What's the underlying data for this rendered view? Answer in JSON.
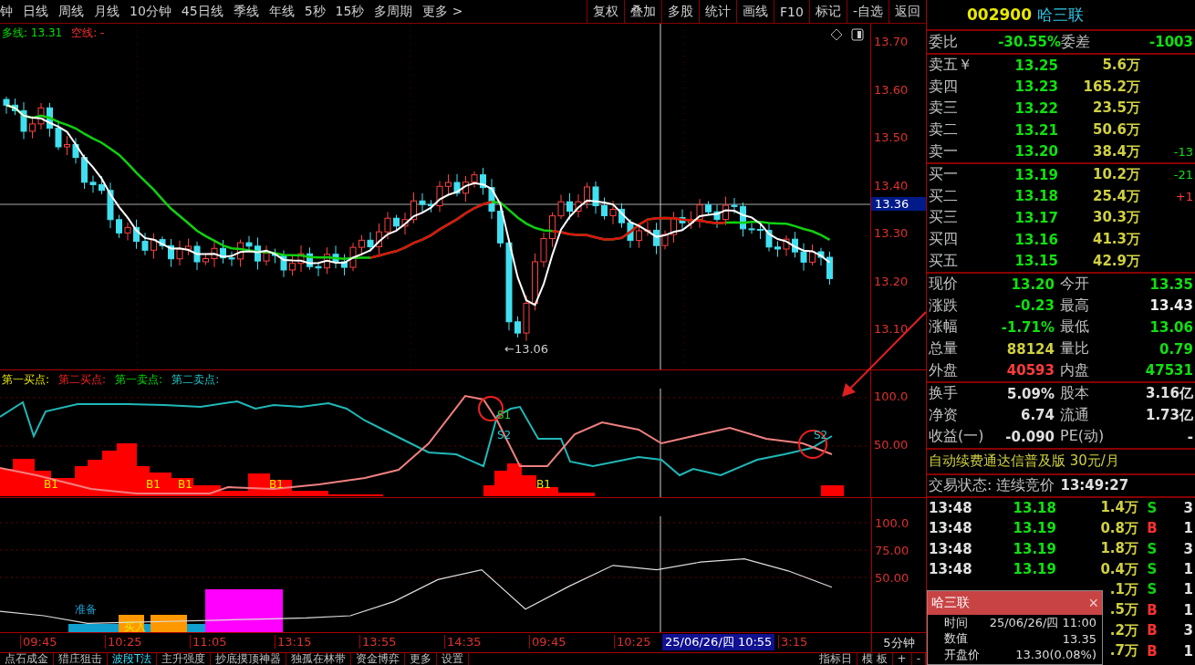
{
  "toolbar": {
    "periods": [
      "钟",
      "日线",
      "周线",
      "月线",
      "10分钟",
      "45日线",
      "季线",
      "年线",
      "5秒",
      "15秒",
      "多周期",
      "更多 >"
    ],
    "actions": [
      "复权",
      "叠加",
      "多股",
      "统计",
      "画线",
      "F10",
      "标记",
      "-自选",
      "返回"
    ]
  },
  "main_chart": {
    "legend": [
      {
        "label": "多线:",
        "value": "13.31",
        "kind": "long"
      },
      {
        "label": "空线:",
        "value": "-",
        "kind": "short"
      }
    ],
    "y_labels": [
      "13.70",
      "13.60",
      "13.50",
      "13.40",
      "13.30",
      "13.20",
      "13.10"
    ],
    "cursor_price": "13.36",
    "low_label": "←13.06"
  },
  "indicator_1": {
    "legend": [
      {
        "label": "第一买点:",
        "kind": "buy1"
      },
      {
        "label": "第二买点:",
        "kind": "buy2"
      },
      {
        "label": "第一卖点:",
        "kind": "sell1"
      },
      {
        "label": "第二卖点:",
        "kind": "sell2"
      }
    ],
    "y_labels": [
      "100.0",
      "50.00"
    ],
    "marks": [
      {
        "text": "B1",
        "kind": "buy"
      },
      {
        "text": "B1",
        "kind": "buy"
      },
      {
        "text": "B1",
        "kind": "buy"
      },
      {
        "text": "B1",
        "kind": "buy"
      },
      {
        "text": "S1",
        "kind": "sell1"
      },
      {
        "text": "S2",
        "kind": "sell2"
      },
      {
        "text": "B1",
        "kind": "buy"
      },
      {
        "text": "S2",
        "kind": "sell2"
      }
    ]
  },
  "indicator_2": {
    "chart_data": {
      "type": "line",
      "grid": true,
      "ylim": [
        -0.8,
        122.5
      ],
      "yticks": [
        {
          "value": 100,
          "label": "100.0"
        },
        {
          "value": 75,
          "label": "75.00"
        },
        {
          "value": 50,
          "label": "50.00"
        }
      ],
      "series": [
        {
          "color": "#dddddd",
          "values": [
            19,
            15,
            8,
            9,
            10,
            11,
            12,
            13,
            15,
            28,
            48,
            57,
            21,
            42,
            61,
            57,
            64,
            67,
            56,
            41
          ]
        }
      ]
    },
    "marks": [
      {
        "text": "准备",
        "kind": "ready"
      },
      {
        "text": "买入",
        "kind": "buy"
      }
    ]
  },
  "x_axis": {
    "labels": [
      "09:45",
      "10:25",
      "11:05",
      "13:15",
      "13:55",
      "14:35",
      "09:45",
      "10:25"
    ],
    "cursor": "25/06/26/四 10:55",
    "cut_label": "3:15",
    "period": "5分钟"
  },
  "bottom_tabs": [
    {
      "label": "点石成金",
      "selected": false
    },
    {
      "label": "猎庄狙击",
      "selected": false
    },
    {
      "label": "波段T法",
      "selected": true
    },
    {
      "label": "主升强度",
      "selected": false
    },
    {
      "label": "抄底摸顶神器",
      "selected": false
    },
    {
      "label": "独孤在林带",
      "selected": false
    },
    {
      "label": "资金博弈",
      "selected": false
    },
    {
      "label": "更多",
      "selected": false
    },
    {
      "label": "设置",
      "selected": false
    }
  ],
  "bottom_actions": [
    "指标日",
    "模 板",
    "+",
    "-"
  ],
  "quote_panel": {
    "code": "002900",
    "name": "哈三联",
    "ratio": {
      "label": "委比",
      "value": "-30.55%",
      "diff_label": "委差",
      "diff": "-1003"
    },
    "asks": [
      {
        "label": "卖五￥",
        "price": "13.25",
        "volume": "5.6万"
      },
      {
        "label": "卖四",
        "price": "13.23",
        "volume": "165.2万"
      },
      {
        "label": "卖三",
        "price": "13.22",
        "volume": "23.5万"
      },
      {
        "label": "卖二",
        "price": "13.21",
        "volume": "50.6万"
      },
      {
        "label": "卖一",
        "price": "13.20",
        "volume": "38.4万",
        "change": "-13",
        "kind": "down"
      }
    ],
    "bids": [
      {
        "label": "买一",
        "price": "13.19",
        "volume": "10.2万",
        "change": "-21",
        "kind": "down"
      },
      {
        "label": "买二",
        "price": "13.18",
        "volume": "25.4万",
        "change": "+1",
        "kind": "up"
      },
      {
        "label": "买三",
        "price": "13.17",
        "volume": "30.3万"
      },
      {
        "label": "买四",
        "price": "13.16",
        "volume": "41.3万"
      },
      {
        "label": "买五",
        "price": "13.15",
        "volume": "42.9万"
      }
    ],
    "stats": [
      [
        {
          "label": "现价",
          "value": "13.20",
          "kind": "down"
        },
        {
          "label": "今开",
          "value": "13.35",
          "kind": "down"
        }
      ],
      [
        {
          "label": "涨跌",
          "value": "-0.23",
          "kind": "down"
        },
        {
          "label": "最高",
          "value": "13.43",
          "kind": "flat"
        }
      ],
      [
        {
          "label": "涨幅",
          "value": "-1.71%",
          "kind": "down"
        },
        {
          "label": "最低",
          "value": "13.06",
          "kind": "down"
        }
      ],
      [
        {
          "label": "总量",
          "value": "88124",
          "kind": "volume"
        },
        {
          "label": "量比",
          "value": "0.79",
          "kind": "down"
        }
      ],
      [
        {
          "label": "外盘",
          "value": "40593",
          "kind": "up"
        },
        {
          "label": "内盘",
          "value": "47531",
          "kind": "down"
        }
      ]
    ],
    "fundamentals": [
      [
        {
          "label": "换手",
          "value": "5.09%"
        },
        {
          "label": "股本",
          "value": "3.16亿"
        }
      ],
      [
        {
          "label": "净资",
          "value": "6.74"
        },
        {
          "label": "流通",
          "value": "1.73亿"
        }
      ],
      [
        {
          "label": "收益(一)",
          "value": "-0.090"
        },
        {
          "label": "PE(动)",
          "value": "-"
        }
      ]
    ],
    "promo": "自动续费通达信普及版  30元/月",
    "status": {
      "label": "交易状态: 连续竞价",
      "time": "13:49:27"
    },
    "trades": [
      {
        "time": "13:48",
        "price": "13.18",
        "volume": "1.4万",
        "side": "S",
        "kind": "sell",
        "count": "3"
      },
      {
        "time": "13:48",
        "price": "13.19",
        "volume": "0.8万",
        "side": "B",
        "kind": "buy",
        "count": "1"
      },
      {
        "time": "13:48",
        "price": "13.19",
        "volume": "1.8万",
        "side": "S",
        "kind": "sell",
        "count": "3"
      },
      {
        "time": "13:48",
        "price": "13.19",
        "volume": "0.4万",
        "side": "S",
        "kind": "sell",
        "count": "1"
      },
      {
        "volume": ".1万",
        "side": "S",
        "kind": "sell",
        "count": "1"
      },
      {
        "volume": ".5万",
        "side": "B",
        "kind": "buy",
        "count": "1"
      },
      {
        "volume": ".2万",
        "side": "B",
        "kind": "buy",
        "count": "3"
      },
      {
        "volume": ".7万",
        "side": "B",
        "kind": "buy",
        "count": "1"
      }
    ],
    "tooltip": {
      "title": "哈三联",
      "close": "×",
      "rows": [
        {
          "label": "时间",
          "value": "25/06/26/四 11:00"
        },
        {
          "label": "数值",
          "value": "13.35"
        },
        {
          "label": "开盘价",
          "value": "13.30(0.08%)"
        }
      ]
    }
  }
}
